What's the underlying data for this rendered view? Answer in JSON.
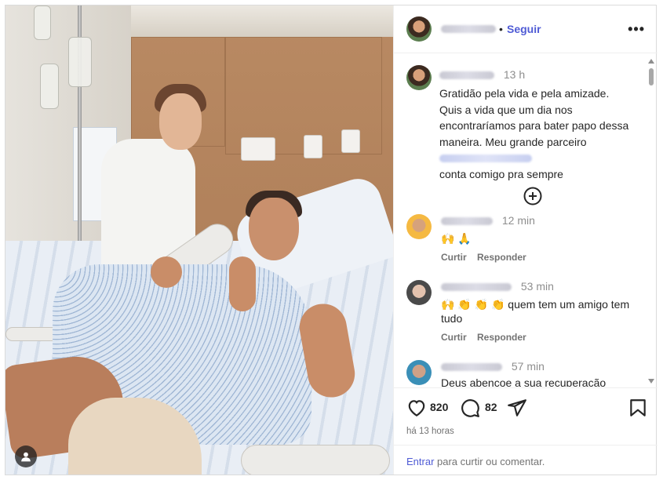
{
  "post": {
    "author_name_blurred": true,
    "follow_label": "Seguir",
    "separator": "•",
    "more_label": "•••"
  },
  "caption": {
    "time": "13 h",
    "text": "Gratidão pela vida e pela amizade. Quis a vida que um dia nos encontraríamos para bater papo dessa maneira. Meu grande parceiro ",
    "mention_blurred": true,
    "text_end": "conta comigo pra sempre"
  },
  "comments": [
    {
      "time": "12 min",
      "text": "🙌 🙏",
      "reply_label": "Responder",
      "like_label": "Curtir",
      "avatar_color": "#f5b942"
    },
    {
      "time": "53 min",
      "text": "🙌 👏 👏 👏 quem tem um amigo tem tudo",
      "reply_label": "Responder",
      "like_label": "Curtir",
      "avatar_color": "#5a5a5a"
    },
    {
      "time": "57 min",
      "text": "Deus abençoe a sua recuperação",
      "avatar_color": "#3a8fb7"
    }
  ],
  "stats": {
    "likes": "820",
    "comments": "82",
    "posted_ago": "há 13 horas"
  },
  "footer": {
    "link": "Entrar",
    "text": " para curtir ou comentar."
  },
  "icons": {
    "more": "more-options-icon",
    "add_comments": "plus-circle-icon",
    "like": "heart-icon",
    "comment": "speech-bubble-icon",
    "share": "paper-plane-icon",
    "save": "bookmark-icon",
    "tag": "user-tag-icon"
  },
  "colors": {
    "accent": "#4f5bd5",
    "muted": "#737373",
    "border": "#dbdbdb"
  }
}
